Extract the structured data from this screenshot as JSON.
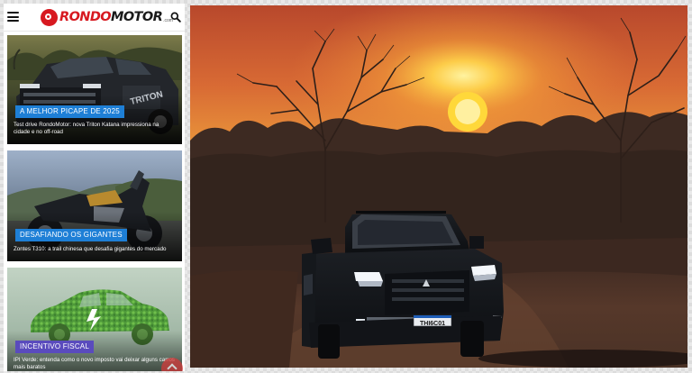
{
  "header": {
    "logo_primary": "RONDO",
    "logo_secondary": "MOTOR",
    "logo_suffix": ".com"
  },
  "cards": [
    {
      "badge": "A MELHOR PICAPE DE 2025",
      "title": "Test drive RondoMotor: nova Triton Katana impressiona na cidade e no off-road"
    },
    {
      "badge": "DESAFIANDO OS GIGANTES",
      "title": "Zontes T310: a trail chinesa que desafia gigantes do mercado"
    },
    {
      "badge": "INCENTIVO FISCAL",
      "title": "IPI Verde: entenda como o novo imposto vai deixar alguns carros mais baratos"
    }
  ],
  "hero": {
    "plate": "THI6C01",
    "sky_top": "#b8482c",
    "sun_color": "#ffd83a"
  },
  "colors": {
    "brand_red": "#d71920",
    "badge_blue": "#1e7fd6",
    "badge_purple": "#5a4bbd"
  },
  "icons": [
    "menu-icon",
    "search-icon",
    "arrow-up-icon"
  ]
}
